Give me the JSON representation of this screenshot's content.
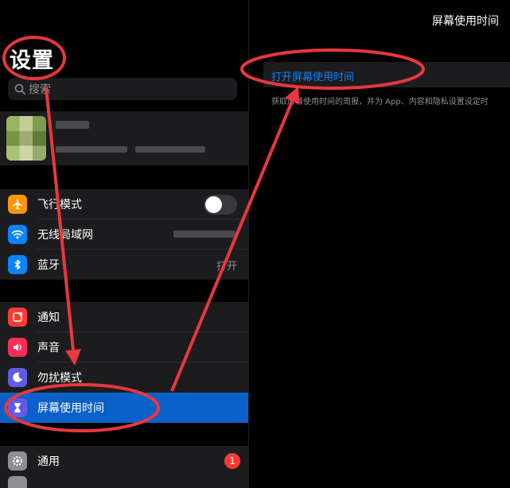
{
  "sidebar": {
    "title": "设置",
    "search_placeholder": "搜索",
    "groups": {
      "connectivity": [
        {
          "label": "飞行模式",
          "icon": "airplane-icon",
          "color": "#ff9500"
        },
        {
          "label": "无线局域网",
          "icon": "wifi-icon",
          "color": "#0a84ff"
        },
        {
          "label": "蓝牙",
          "icon": "bluetooth-icon",
          "color": "#0a84ff",
          "value": "打开"
        }
      ],
      "notifications": [
        {
          "label": "通知",
          "icon": "notifications-icon",
          "color": "#ff3b30"
        },
        {
          "label": "声音",
          "icon": "sound-icon",
          "color": "#ff2d55"
        },
        {
          "label": "勿扰模式",
          "icon": "moon-icon",
          "color": "#5e5ce6"
        },
        {
          "label": "屏幕使用时间",
          "icon": "hourglass-icon",
          "color": "#5e5ce6",
          "selected": true
        }
      ],
      "general": [
        {
          "label": "通用",
          "icon": "gear-icon",
          "color": "#8e8e93",
          "badge": "1"
        }
      ]
    }
  },
  "main": {
    "title": "屏幕使用时间",
    "open_link": "打开屏幕使用时间",
    "description": "获取屏幕使用时间的周报，并为 App、内容和隐私设置设定时"
  },
  "colors": {
    "accent": "#0a84ff",
    "selected_row": "#0a60c9",
    "annotation": "#e8383d"
  }
}
